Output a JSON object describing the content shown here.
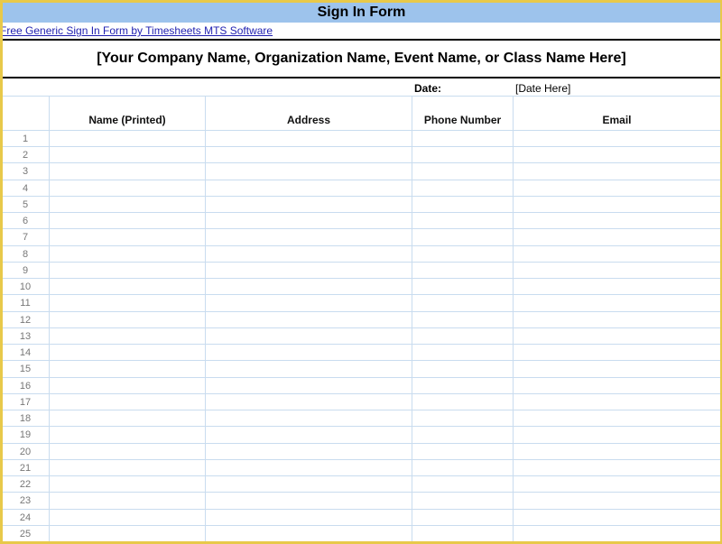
{
  "form": {
    "title": "Sign In Form",
    "link_text": "Free Generic Sign In Form by Timesheets MTS Software",
    "company_placeholder": "[Your Company Name, Organization Name, Event Name, or Class Name Here]",
    "date_label": "Date:",
    "date_placeholder": "[Date Here]"
  },
  "table": {
    "columns": [
      "Name (Printed)",
      "Address",
      "Phone Number",
      "Email"
    ],
    "row_numbers": [
      "1",
      "2",
      "3",
      "4",
      "5",
      "6",
      "7",
      "8",
      "9",
      "10",
      "11",
      "12",
      "13",
      "14",
      "15",
      "16",
      "17",
      "18",
      "19",
      "20",
      "21",
      "22",
      "23",
      "24",
      "25"
    ]
  },
  "colors": {
    "title_bar": "#9dc3ec",
    "frame": "#e8c94a",
    "grid_lines": "#c9dcef",
    "link": "#1f1fb0"
  }
}
